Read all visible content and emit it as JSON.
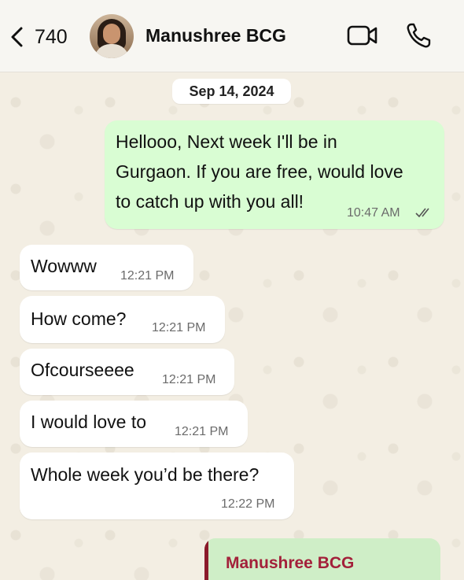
{
  "header": {
    "back_count": "740",
    "contact_name": "Manushree BCG"
  },
  "date_chip": "Sep 14, 2024",
  "messages": [
    {
      "direction": "out",
      "lines": [
        "Hellooo, Next week I'll be in",
        "Gurgaon. If you are free, would love",
        "to catch up with you all!"
      ],
      "time": "10:47 AM",
      "status": "read"
    },
    {
      "direction": "in",
      "text": "Wowww",
      "time": "12:21 PM"
    },
    {
      "direction": "in",
      "text": "How come?",
      "time": "12:21 PM"
    },
    {
      "direction": "in",
      "text": "Ofcourseeee",
      "time": "12:21 PM"
    },
    {
      "direction": "in",
      "text": "I would love to",
      "time": "12:21 PM"
    },
    {
      "direction": "in",
      "text": "Whole week you’d be there?",
      "time": "12:22 PM"
    }
  ],
  "reply_preview": {
    "name": "Manushree BCG"
  },
  "colors": {
    "outgoing_bubble": "#d9fdd3",
    "incoming_bubble": "#ffffff",
    "reply_name": "#a3203a"
  },
  "icons": [
    "chevron-left-icon",
    "video-camera-icon",
    "phone-icon",
    "double-check-icon"
  ]
}
